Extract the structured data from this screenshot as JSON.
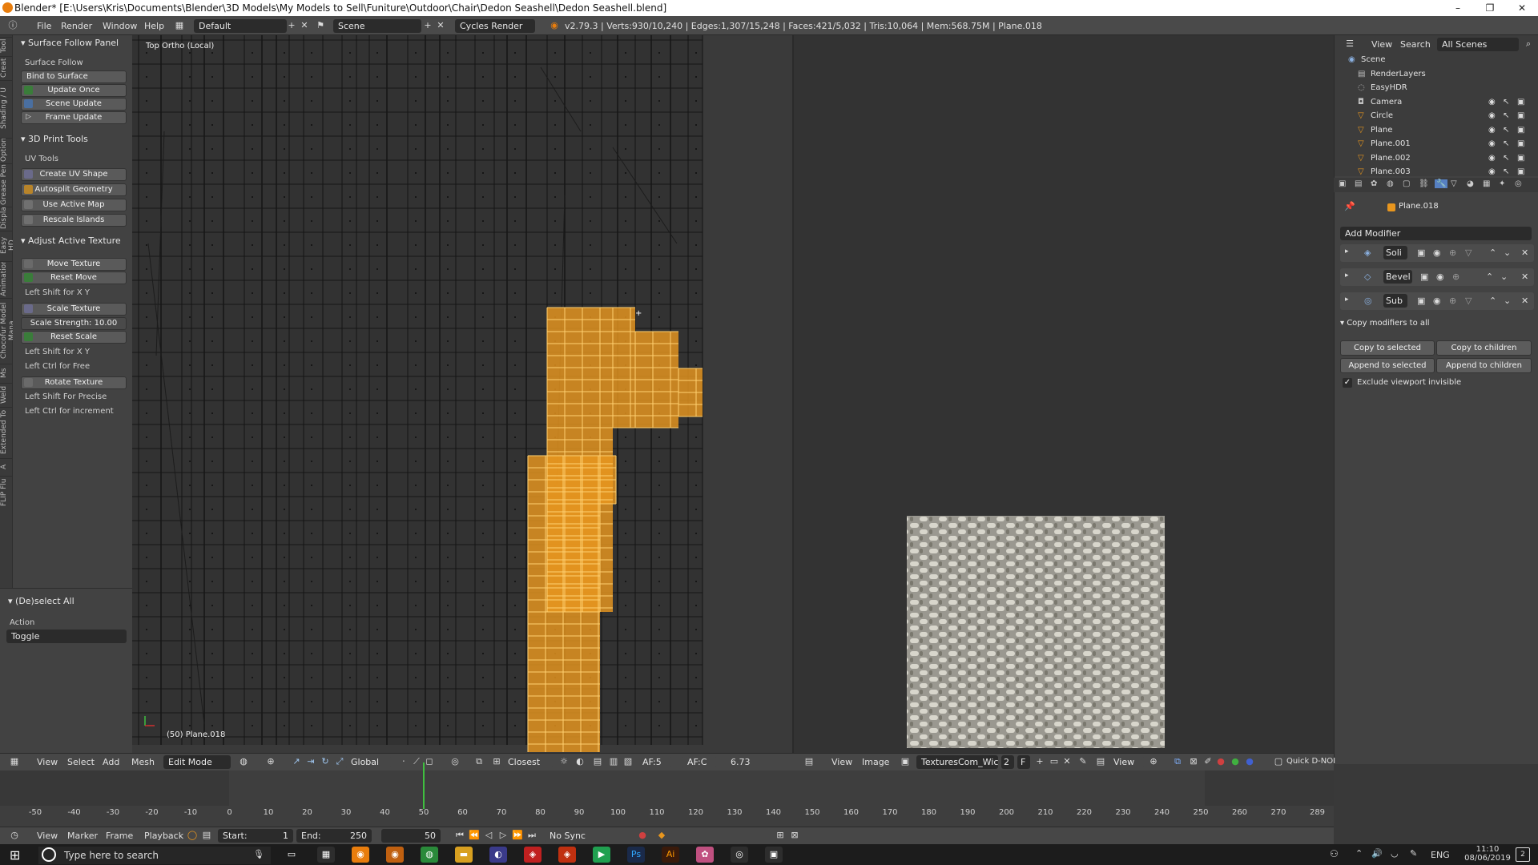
{
  "window": {
    "title": "Blender* [E:\\Users\\Kris\\Documents\\Blender\\3D Models\\My Models to Sell\\Funiture\\Outdoor\\Chair\\Dedon Seashell\\Dedon Seashell.blend]",
    "minimize": "–",
    "maximize": "❐",
    "close": "✕"
  },
  "infobar": {
    "menus": [
      "File",
      "Render",
      "Window",
      "Help"
    ],
    "layout": "Default",
    "scene": "Scene",
    "engine": "Cycles Render",
    "stats": "v2.79.3 | Verts:930/10,240 | Edges:1,307/15,248 | Faces:421/5,032 | Tris:10,064 | Mem:568.75M | Plane.018"
  },
  "vtabs": [
    "Tool",
    "Creat",
    "Shading / U",
    "Option",
    "Grease Pen",
    "Displa",
    "Easy HD",
    "Animation",
    "Chocofur Model Mana",
    "Ms",
    "Weld",
    "Extended To",
    "A",
    "FLIP Flu"
  ],
  "toolshelf": {
    "surface_follow": {
      "header": "Surface Follow Panel",
      "sub": "Surface Follow",
      "bind": "Bind to Surface",
      "update_once": "Update Once",
      "scene_update": "Scene Update",
      "frame_update": "Frame Update"
    },
    "print3d": {
      "header": "3D Print Tools"
    },
    "uv_tools": {
      "sub": "UV Tools",
      "create_uv_shape": "Create UV Shape",
      "autosplit": "Autosplit Geometry",
      "use_active_map": "Use Active Map",
      "rescale_islands": "Rescale Islands"
    },
    "adjust": {
      "header": "Adjust Active Texture",
      "move_texture": "Move Texture",
      "reset_move": "Reset Move",
      "hint_shift_xy": "Left Shift for X Y",
      "scale_texture": "Scale Texture",
      "scale_strength_label": "Scale Strength:",
      "scale_strength_value": "10.00",
      "reset_scale": "Reset Scale",
      "hint_shift_xy2": "Left Shift for X Y",
      "hint_ctrl_free": "Left Ctrl for Free",
      "rotate_texture": "Rotate Texture",
      "hint_shift_precise": "Left Shift For Precise",
      "hint_ctrl_increment": "Left Ctrl for increment"
    },
    "deselect": {
      "header": "(De)select All",
      "action_label": "Action",
      "action_value": "Toggle"
    }
  },
  "viewport": {
    "view_label": "Top Ortho (Local)",
    "object_label": "(50) Plane.018"
  },
  "header3d": {
    "menus": [
      "View",
      "Select",
      "Add",
      "Mesh"
    ],
    "mode": "Edit Mode",
    "orientation": "Global",
    "snap": "Closest",
    "af5": "AF:5",
    "afc": "AF:C",
    "value": "6.73"
  },
  "image_editor": {
    "menus": [
      "View",
      "Image"
    ],
    "image_name": "TexturesCom_Wic...",
    "users": "2",
    "fake": "F",
    "view_label": "View",
    "quick": "Quick D-NOI"
  },
  "outliner": {
    "view": "View",
    "search": "Search",
    "filter": "All Scenes",
    "rows": [
      "Scene",
      "RenderLayers",
      "EasyHDR",
      "Camera",
      "Circle",
      "Plane",
      "Plane.001",
      "Plane.002",
      "Plane.003"
    ]
  },
  "properties": {
    "object": "Plane.018",
    "add_modifier": "Add Modifier",
    "modifiers": [
      "Soli",
      "Bevel",
      "Sub"
    ],
    "copy_header": "Copy modifiers to all",
    "copy_to_selected": "Copy to selected",
    "copy_to_children": "Copy to children",
    "append_to_selected": "Append to selected",
    "append_to_children": "Append to children",
    "exclude_label": "Exclude viewport invisible",
    "exclude_checked": true
  },
  "timeline": {
    "ticks": [
      "-50",
      "-40",
      "-30",
      "-20",
      "-10",
      "0",
      "10",
      "20",
      "30",
      "40",
      "50",
      "60",
      "70",
      "80",
      "90",
      "100",
      "110",
      "120",
      "130",
      "140",
      "150",
      "160",
      "170",
      "180",
      "190",
      "200",
      "210",
      "220",
      "230",
      "240",
      "250",
      "260",
      "270",
      "289"
    ],
    "current_frame": 50,
    "menus": [
      "View",
      "Marker",
      "Frame",
      "Playback"
    ],
    "start_label": "Start:",
    "start": "1",
    "end_label": "End:",
    "end": "250",
    "frame": "50",
    "sync": "No Sync"
  },
  "taskbar": {
    "search_placeholder": "Type here to search",
    "lang": "ENG",
    "time": "11:10",
    "date": "08/06/2019",
    "notif": "2"
  },
  "colors": {
    "selection": "#e8961e",
    "accent": "#e87d0d",
    "playhead": "#3fbf3f"
  }
}
